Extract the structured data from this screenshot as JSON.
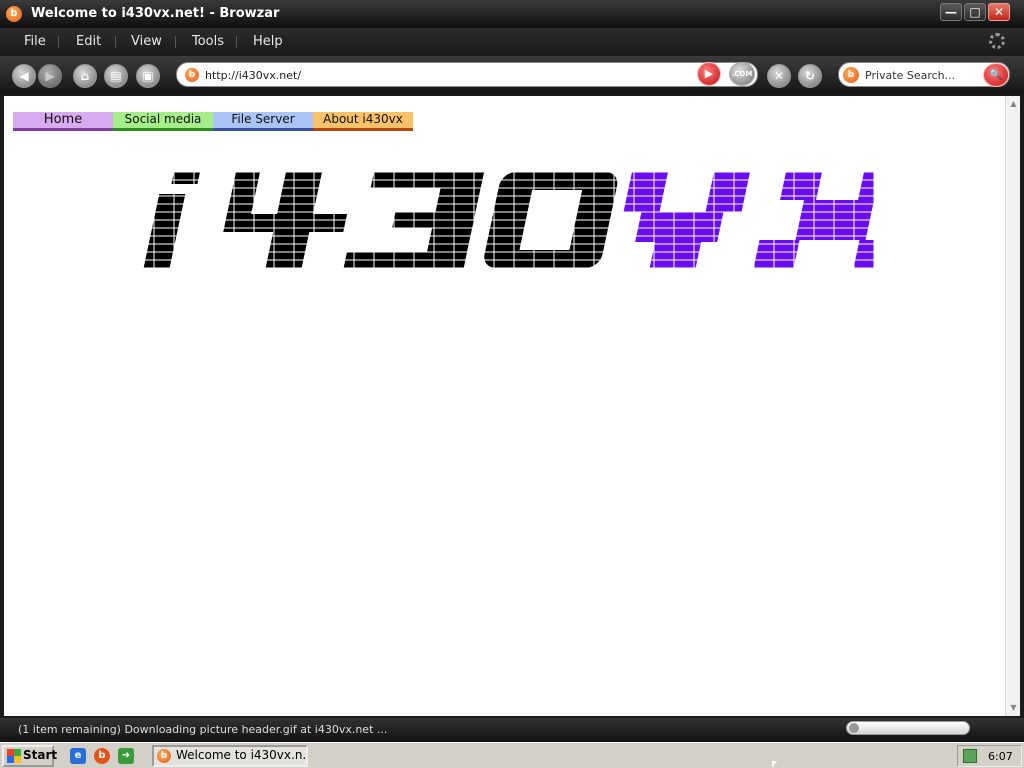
{
  "window": {
    "title": "Welcome to i430vx.net! - Browzar",
    "app_icon_glyph": "b",
    "minimize_glyph": "—",
    "maximize_glyph": "□",
    "close_glyph": "✕"
  },
  "menu": {
    "items": [
      "File",
      "Edit",
      "View",
      "Tools",
      "Help"
    ]
  },
  "toolbar": {
    "back_glyph": "◀",
    "forward_glyph": "▶",
    "home_glyph": "⌂",
    "print_glyph": "▤",
    "history_glyph": "▣",
    "go_glyph": "▶",
    "com_label": ".COM",
    "stop_glyph": "✕",
    "refresh_glyph": "↻"
  },
  "address": {
    "url": "http://i430vx.net/"
  },
  "search": {
    "placeholder": "Private Search...",
    "go_glyph": "🔍"
  },
  "site": {
    "nav": [
      {
        "label": "Home",
        "color": "#d8aaf0"
      },
      {
        "label": "Social media",
        "color": "#a6ee8a"
      },
      {
        "label": "File Server",
        "color": "#a9c4f5"
      },
      {
        "label": "About i430vx",
        "color": "#f7c26a"
      }
    ],
    "logo": {
      "text_part_1": "i430",
      "text_part_2": "vx",
      "color_1": "#000000",
      "color_2": "#6a0cf2"
    }
  },
  "status": {
    "text": "(1 item remaining) Downloading picture header.gif at i430vx.net ..."
  },
  "taskbar": {
    "start_label": "Start",
    "task_label": "Welcome to i430vx.n...",
    "clock": "6:07"
  }
}
